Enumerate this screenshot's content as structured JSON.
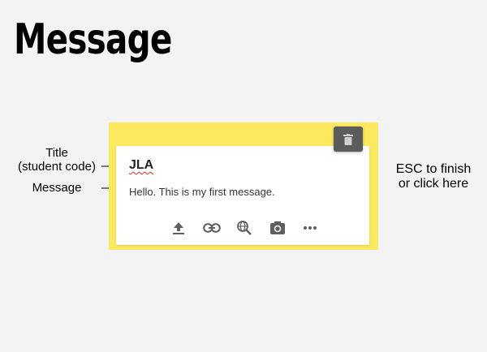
{
  "page": {
    "title": "Message"
  },
  "annotations": {
    "title_line1": "Title",
    "title_line2": "(student code)",
    "message": "Message",
    "esc_line1": "ESC to finish",
    "esc_line2": "or click here"
  },
  "post": {
    "title": "JLA",
    "body": "Hello. This is my first message.",
    "frame_color": "#fde95f"
  },
  "toolbar": {
    "icons": [
      "upload-icon",
      "link-icon",
      "search-web-icon",
      "camera-icon",
      "more-icon"
    ]
  },
  "delete_button": {
    "icon": "trash-icon"
  }
}
